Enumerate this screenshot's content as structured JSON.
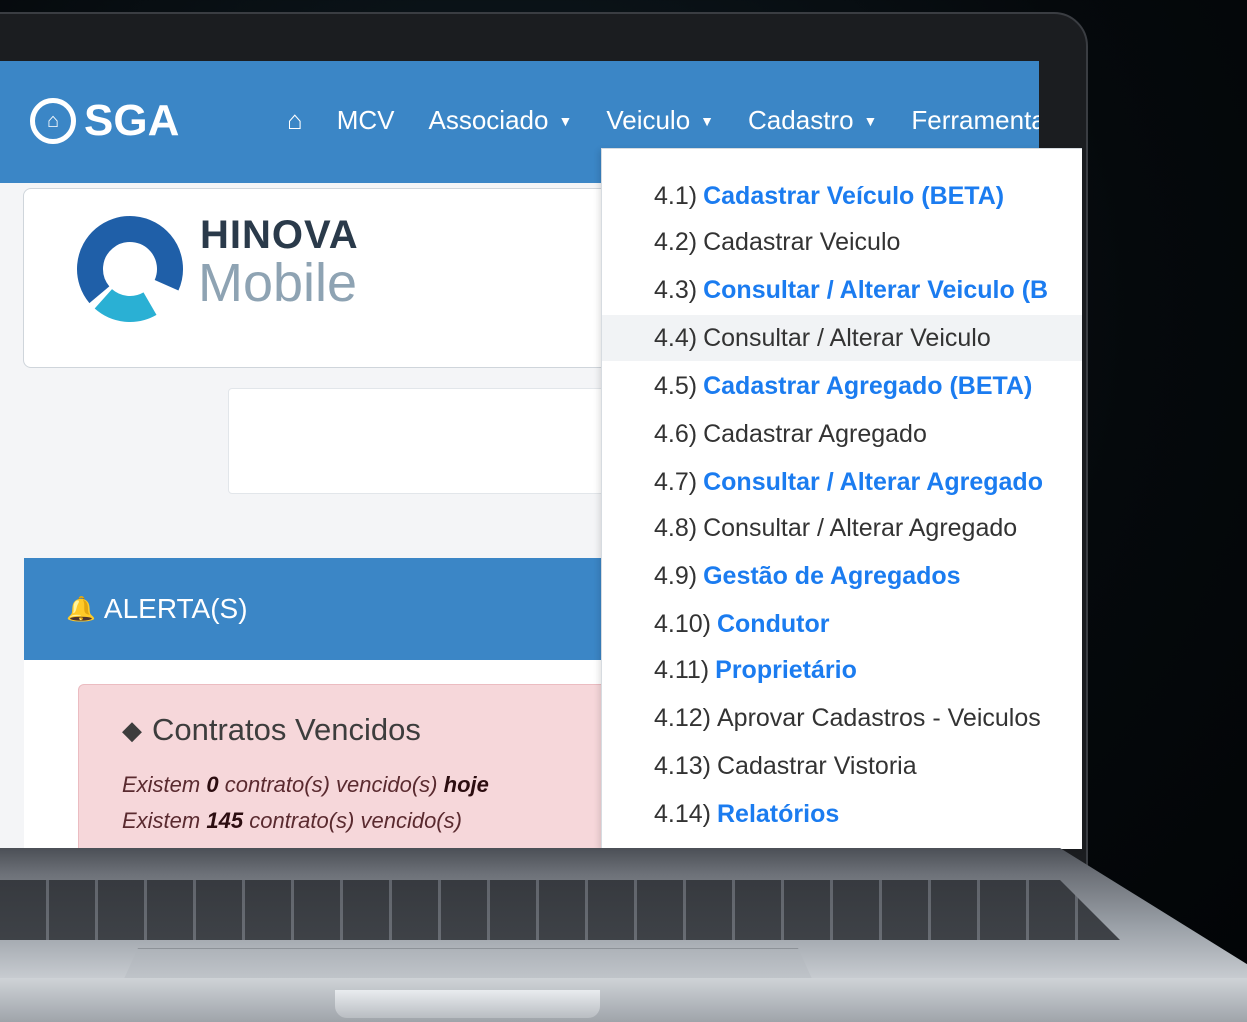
{
  "navbar": {
    "brand": "SGA",
    "home_icon": "home-icon",
    "items": [
      {
        "label": "MCV",
        "dropdown": false
      },
      {
        "label": "Associado",
        "dropdown": true
      },
      {
        "label": "Veiculo",
        "dropdown": true
      },
      {
        "label": "Cadastro",
        "dropdown": true
      },
      {
        "label": "Ferramentas",
        "dropdown": false
      }
    ]
  },
  "logo": {
    "line1": "HINOVA",
    "line2": "Mobile"
  },
  "alerts": {
    "header": "ALERTA(S)",
    "card": {
      "title": "Contratos Vencidos",
      "line1": {
        "prefix": "Existem",
        "count": "0",
        "middle": "contrato(s) vencido(s)",
        "suffix": "hoje"
      },
      "line2": {
        "prefix": "Existem",
        "count": "145",
        "middle": "contrato(s) vencido(s)"
      }
    }
  },
  "veiculo_menu": [
    {
      "num": "4.1)",
      "label": "Cadastrar Veículo (BETA)",
      "beta": true
    },
    {
      "num": "4.2)",
      "label": "Cadastrar Veiculo",
      "beta": false
    },
    {
      "num": "4.3)",
      "label": "Consultar / Alterar Veiculo (B",
      "beta": true
    },
    {
      "num": "4.4)",
      "label": "Consultar / Alterar Veiculo",
      "beta": false,
      "active": true
    },
    {
      "num": "4.5)",
      "label": "Cadastrar Agregado (BETA)",
      "beta": true
    },
    {
      "num": "4.6)",
      "label": "Cadastrar Agregado",
      "beta": false
    },
    {
      "num": "4.7)",
      "label": "Consultar / Alterar Agregado",
      "beta": true
    },
    {
      "num": "4.8)",
      "label": "Consultar / Alterar Agregado",
      "beta": false
    },
    {
      "num": "4.9)",
      "label": "Gestão de Agregados",
      "beta": true
    },
    {
      "num": "4.10)",
      "label": "Condutor",
      "beta": true
    },
    {
      "num": "4.11)",
      "label": "Proprietário",
      "beta": true
    },
    {
      "num": "4.12)",
      "label": "Aprovar Cadastros - Veiculos",
      "beta": false
    },
    {
      "num": "4.13)",
      "label": "Cadastrar Vistoria",
      "beta": false
    },
    {
      "num": "4.14)",
      "label": "Relatórios",
      "beta": true
    }
  ],
  "colors": {
    "navbar": "#3b86c6",
    "link_bold": "#1b7cf0",
    "alert_bg": "#f6d7da"
  }
}
